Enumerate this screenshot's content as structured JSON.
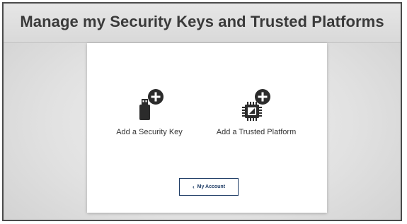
{
  "header": {
    "title": "Manage my Security Keys and Trusted Platforms"
  },
  "options": [
    {
      "label": "Add a Security Key",
      "icon": "usb-key-add-icon"
    },
    {
      "label": "Add a Trusted Platform",
      "icon": "chip-add-icon"
    }
  ],
  "account_button": {
    "chevron": "‹",
    "label": "My Account"
  },
  "colors": {
    "icon": "#2b2b2b",
    "button_accent": "#1f3d66",
    "title_text": "#3a3a3a"
  }
}
